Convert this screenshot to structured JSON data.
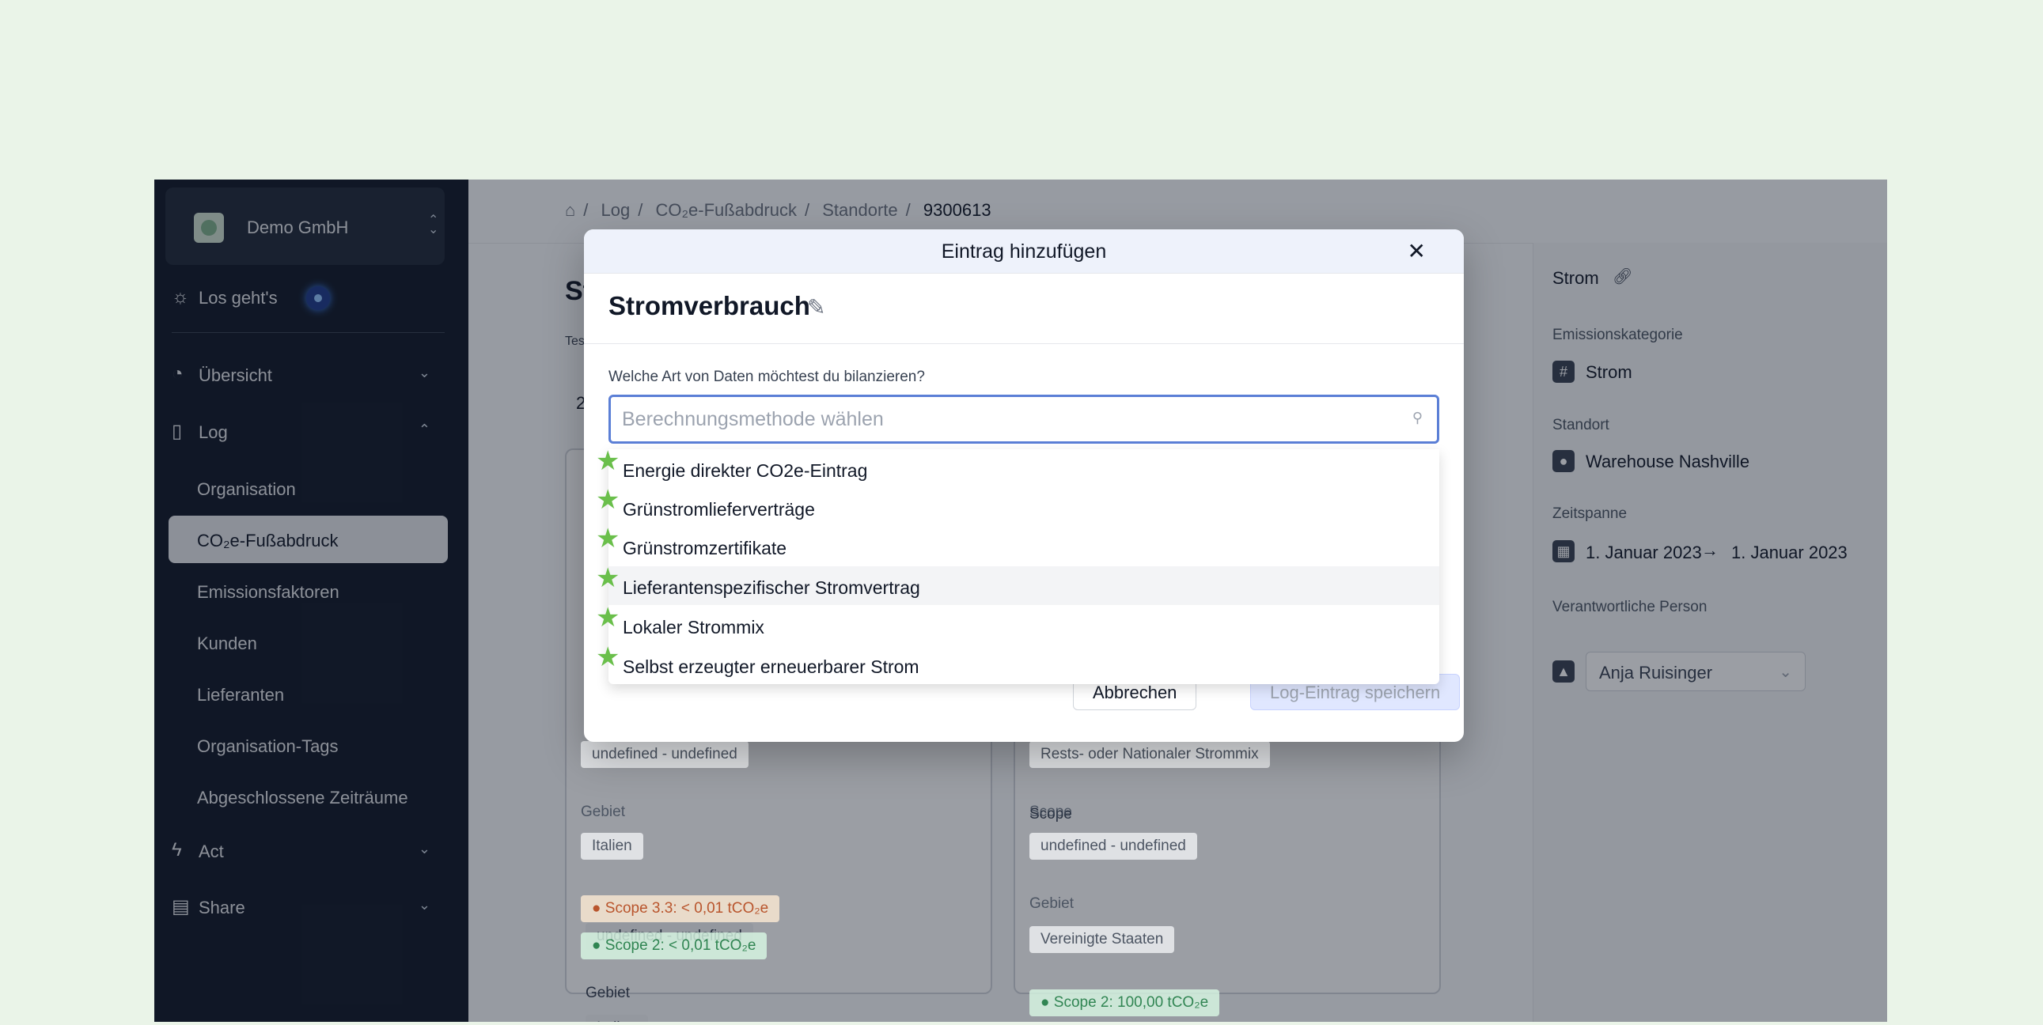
{
  "sidebar": {
    "org_name": "Demo GmbH",
    "start_label": "Los geht's",
    "sections": {
      "overview": "Übersicht",
      "log": "Log",
      "act": "Act",
      "share": "Share"
    },
    "log_items": [
      "Organisation",
      "CO₂e-Fußabdruck",
      "Emissionsfaktoren",
      "Kunden",
      "Lieferanten",
      "Organisation-Tags",
      "Abgeschlossene Zeiträume"
    ]
  },
  "breadcrumb": [
    "Log",
    "CO₂e-Fußabdruck",
    "Standorte",
    "9300613"
  ],
  "page": {
    "title_partial": "St",
    "sub_partial": "Tes",
    "num_partial": "2"
  },
  "cards": {
    "left": {
      "pill_top": "undefined - undefined",
      "gebiet_label": "Gebiet",
      "gebiet_value": "Italien",
      "tag1": "Scope 3.3: < 0,01 tCO₂e",
      "tag2": "Scope 2: < 0,01 tCO₂e"
    },
    "right": {
      "pill_top": "Rests- oder Nationaler Strommix",
      "scope_label": "Scope",
      "scope_value": "undefined - undefined",
      "gebiet_label": "Gebiet",
      "gebiet_value": "Vereinigte Staaten",
      "tag1": "Scope 2: 100,00 tCO₂e"
    }
  },
  "panel": {
    "title": "Strom",
    "category_label": "Emissionskategorie",
    "category_value": "Strom",
    "location_label": "Standort",
    "location_value": "Warehouse Nashville",
    "period_label": "Zeitspanne",
    "period_from": "1. Januar 2023",
    "period_to": "1. Januar 2023",
    "person_label": "Verantwortliche Person",
    "person_value": "Anja Ruisinger"
  },
  "modal": {
    "title": "Eintrag hinzufügen",
    "heading": "Stromverbrauch",
    "question": "Welche Art von Daten möchtest du bilanzieren?",
    "search_placeholder": "Berechnungsmethode wählen",
    "options": [
      "Energie direkter CO2e-Eintrag",
      "Grünstromlieferverträge",
      "Grünstromzertifikate",
      "Lieferantenspezifischer Stromvertrag",
      "Lokaler Strommix",
      "Selbst erzeugter erneuerbarer Strom"
    ],
    "highlighted_option_index": 3,
    "cancel_label": "Abbrechen",
    "save_label": "Log-Eintrag speichern"
  },
  "colors": {
    "sidebar_bg": "#111827",
    "accent": "#5b7fd6",
    "star": "#6abf4b",
    "page_bg": "#eaf4e8"
  },
  "icons": [
    "home-icon",
    "lightbulb-icon",
    "pie-chart-icon",
    "book-icon",
    "bolt-icon",
    "document-icon",
    "close-icon",
    "edit-icon",
    "search-icon",
    "star-icon",
    "link-icon",
    "hash-icon",
    "lock-icon",
    "pin-icon",
    "calendar-icon",
    "arrow-right-icon",
    "person-icon",
    "chevron-down-icon",
    "chevron-up-icon",
    "sort-icon"
  ]
}
